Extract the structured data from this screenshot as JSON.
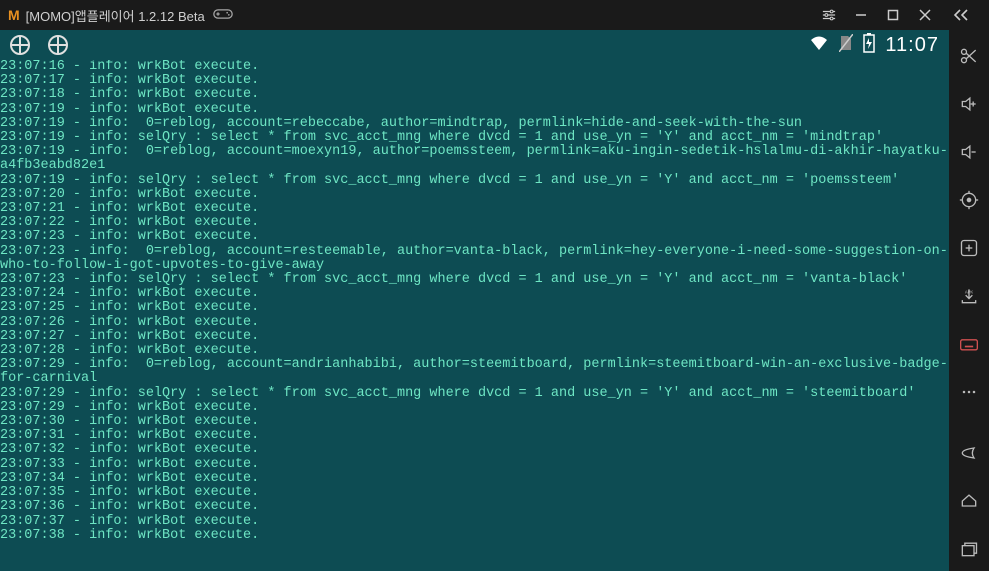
{
  "window": {
    "title": "[MOMO]앱플레이어 1.2.12 Beta"
  },
  "statusbar": {
    "clock": "11:07"
  },
  "log_lines": [
    "23:07:16 - info: wrkBot execute.",
    "23:07:17 - info: wrkBot execute.",
    "23:07:18 - info: wrkBot execute.",
    "23:07:19 - info: wrkBot execute.",
    "23:07:19 - info:  0=reblog, account=rebeccabe, author=mindtrap, permlink=hide-and-seek-with-the-sun",
    "23:07:19 - info: selQry : select * from svc_acct_mng where dvcd = 1 and use_yn = 'Y' and acct_nm = 'mindtrap'",
    "23:07:19 - info:  0=reblog, account=moexyn19, author=poemssteem, permlink=aku-ingin-sedetik-hslalmu-di-akhir-hayatku-a4fb3eabd82e1",
    "23:07:19 - info: selQry : select * from svc_acct_mng where dvcd = 1 and use_yn = 'Y' and acct_nm = 'poemssteem'",
    "23:07:20 - info: wrkBot execute.",
    "23:07:21 - info: wrkBot execute.",
    "23:07:22 - info: wrkBot execute.",
    "23:07:23 - info: wrkBot execute.",
    "23:07:23 - info:  0=reblog, account=resteemable, author=vanta-black, permlink=hey-everyone-i-need-some-suggestion-on-who-to-follow-i-got-upvotes-to-give-away",
    "23:07:23 - info: selQry : select * from svc_acct_mng where dvcd = 1 and use_yn = 'Y' and acct_nm = 'vanta-black'",
    "23:07:24 - info: wrkBot execute.",
    "23:07:25 - info: wrkBot execute.",
    "23:07:26 - info: wrkBot execute.",
    "23:07:27 - info: wrkBot execute.",
    "23:07:28 - info: wrkBot execute.",
    "23:07:29 - info:  0=reblog, account=andrianhabibi, author=steemitboard, permlink=steemitboard-win-an-exclusive-badge-for-carnival",
    "23:07:29 - info: selQry : select * from svc_acct_mng where dvcd = 1 and use_yn = 'Y' and acct_nm = 'steemitboard'",
    "23:07:29 - info: wrkBot execute.",
    "23:07:30 - info: wrkBot execute.",
    "23:07:31 - info: wrkBot execute.",
    "23:07:32 - info: wrkBot execute.",
    "23:07:33 - info: wrkBot execute.",
    "23:07:34 - info: wrkBot execute.",
    "23:07:35 - info: wrkBot execute.",
    "23:07:36 - info: wrkBot execute.",
    "23:07:37 - info: wrkBot execute.",
    "23:07:38 - info: wrkBot execute."
  ]
}
